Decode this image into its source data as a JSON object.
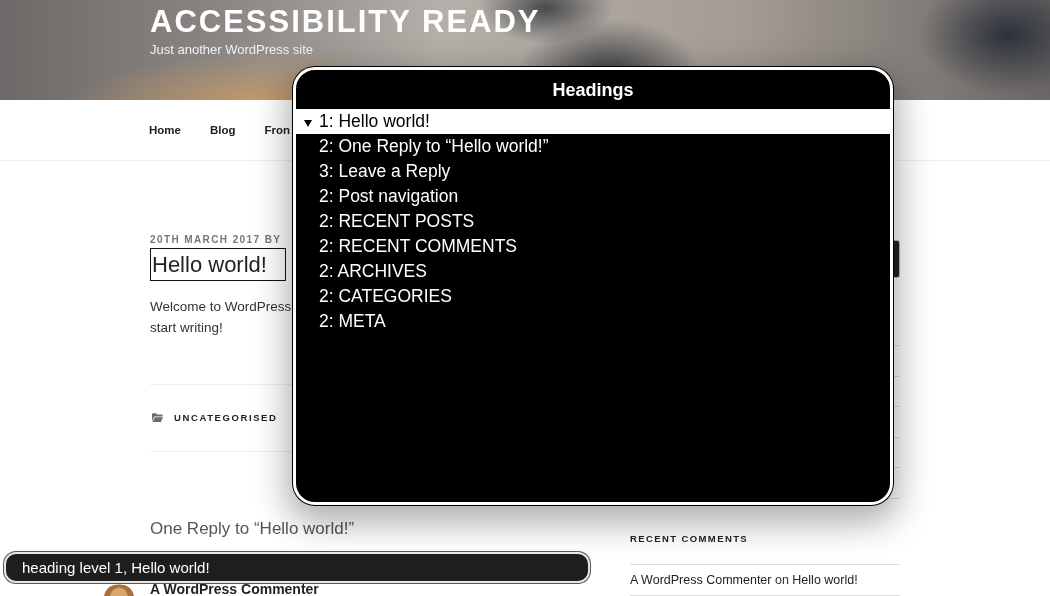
{
  "site_header": {
    "title": "ACCESSIBILITY READY",
    "tagline": "Just another WordPress site"
  },
  "nav": {
    "items": [
      "Home",
      "Blog",
      "Fron"
    ]
  },
  "post": {
    "meta": "20TH MARCH 2017 BY",
    "title": {
      "text": "Hello world!",
      "focused": true
    },
    "excerpt_lines": [
      "Welcome to WordPress",
      "start writing!"
    ],
    "category": "UNCATEGORISED"
  },
  "comments": {
    "title": "One Reply to “Hello world!”",
    "author": "A WordPress Commenter"
  },
  "sidebar": {
    "recent_comments": {
      "title": "RECENT COMMENTS",
      "author": "A WordPress Commenter",
      "connector": "on",
      "post": "Hello world!"
    }
  },
  "headings_rotor": {
    "title": "Headings",
    "items": [
      {
        "label": "1: Hello world!",
        "selected": true
      },
      {
        "label": "2: One Reply to “Hello world!”",
        "selected": false
      },
      {
        "label": "3: Leave a Reply",
        "selected": false
      },
      {
        "label": "2: Post navigation",
        "selected": false
      },
      {
        "label": "2: RECENT POSTS",
        "selected": false
      },
      {
        "label": "2: RECENT COMMENTS",
        "selected": false
      },
      {
        "label": "2: ARCHIVES",
        "selected": false
      },
      {
        "label": "2: CATEGORIES",
        "selected": false
      },
      {
        "label": "2: META",
        "selected": false
      }
    ]
  },
  "caption": {
    "text": "heading level 1, Hello world!"
  }
}
